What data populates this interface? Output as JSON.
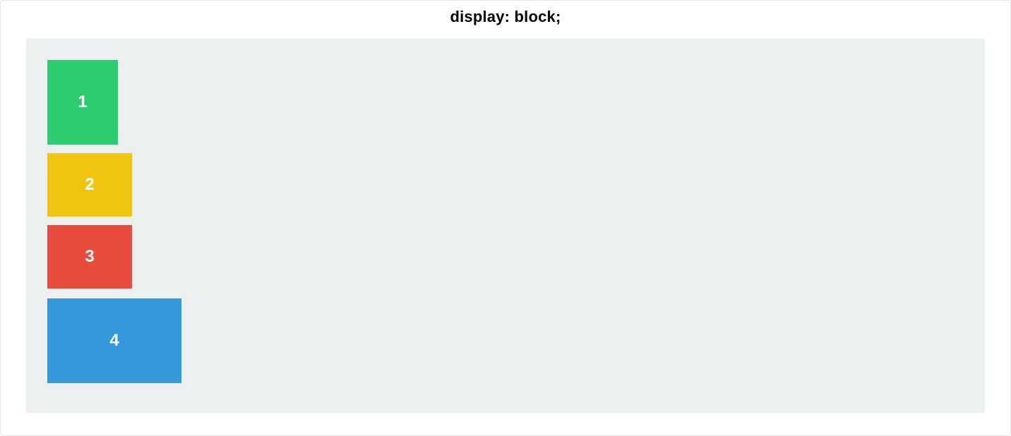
{
  "title": "display: block;",
  "boxes": [
    {
      "label": "1",
      "color": "#2ecc71",
      "width": 100,
      "height": 120
    },
    {
      "label": "2",
      "color": "#f1c40f",
      "width": 120,
      "height": 90
    },
    {
      "label": "3",
      "color": "#e74c3c",
      "width": 120,
      "height": 90
    },
    {
      "label": "4",
      "color": "#3498db",
      "width": 190,
      "height": 120
    }
  ]
}
